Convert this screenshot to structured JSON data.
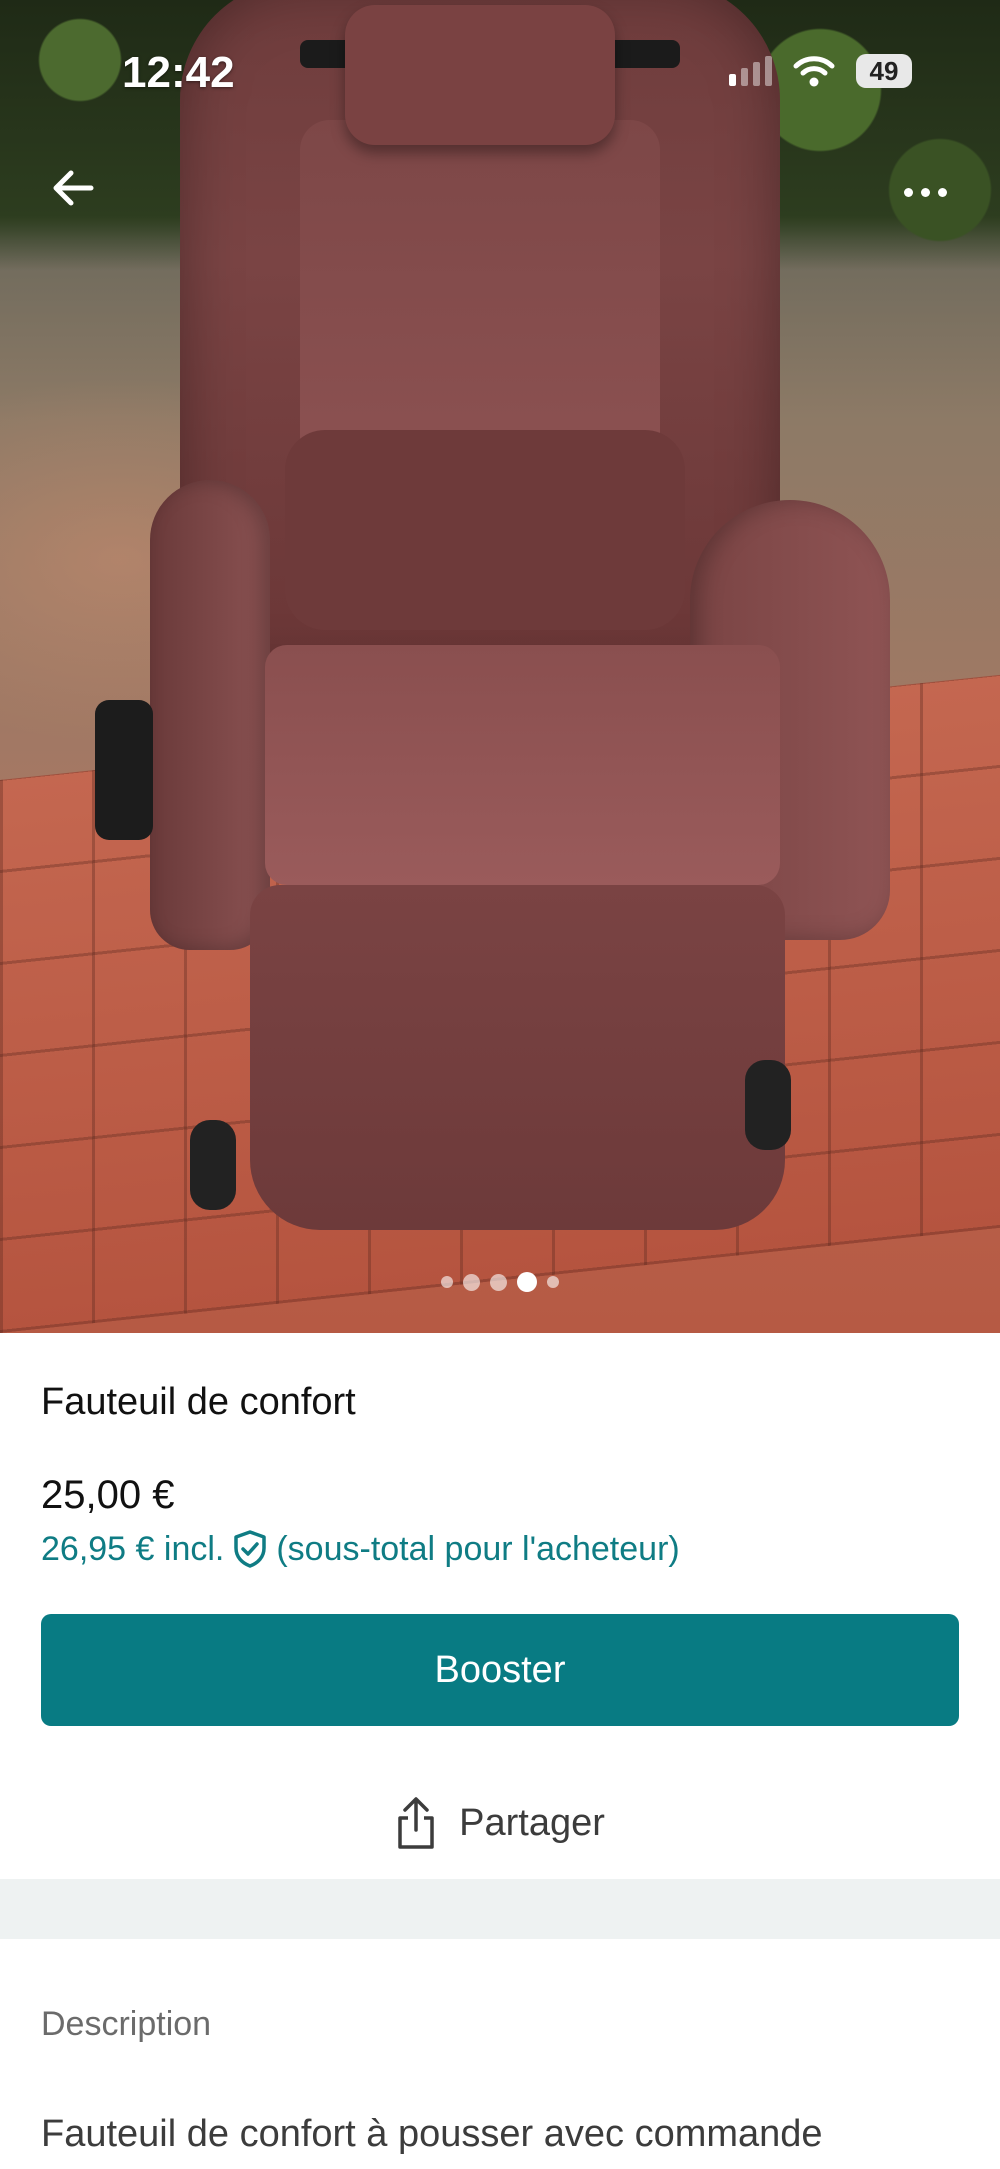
{
  "status_bar": {
    "time": "12:42",
    "battery": "49",
    "icons": [
      "cellular-signal-icon",
      "wifi-icon",
      "battery-icon"
    ]
  },
  "nav": {
    "back_icon": "arrow-left-icon",
    "more_icon": "more-horizontal-icon"
  },
  "gallery": {
    "image_count": 5,
    "active_index": 3
  },
  "listing": {
    "title": "Fauteuil de confort",
    "price": "25,00 €",
    "price_incl": "26,95 € incl.",
    "price_incl_note": "(sous-total pour l'acheteur)"
  },
  "actions": {
    "booster_label": "Booster",
    "share_label": "Partager"
  },
  "description": {
    "label": "Description",
    "text": "Fauteuil de confort à pousser avec commande"
  },
  "colors": {
    "accent": "#087b83",
    "accent_text": "#0f7c84",
    "divider": "#eef2f2"
  }
}
